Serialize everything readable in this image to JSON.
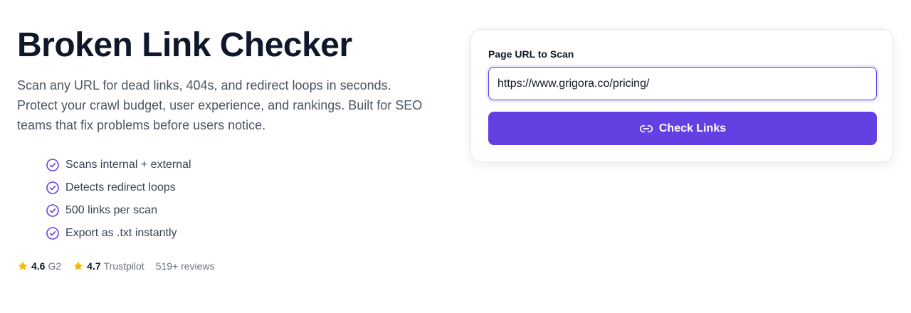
{
  "hero": {
    "title": "Broken Link Checker",
    "description": "Scan any URL for dead links, 404s, and redirect loops in seconds. Protect your crawl budget, user experience, and rankings. Built for SEO teams that fix problems before users notice."
  },
  "features": [
    {
      "icon": "check-circle-icon",
      "label": "Scans internal + external"
    },
    {
      "icon": "check-circle-icon",
      "label": "Detects redirect loops"
    },
    {
      "icon": "check-circle-icon",
      "label": "500 links per scan"
    },
    {
      "icon": "check-circle-icon",
      "label": "Export as .txt instantly"
    }
  ],
  "ratings": [
    {
      "icon": "star-icon",
      "score": "4.6",
      "source": "G2"
    },
    {
      "icon": "star-icon",
      "score": "4.7",
      "source": "Trustpilot"
    }
  ],
  "reviews": "519+ reviews",
  "form": {
    "label": "Page URL to Scan",
    "url_value": "https://www.grigora.co/pricing/",
    "button_label": "Check Links",
    "button_icon": "link-icon"
  },
  "colors": {
    "accent": "#6440e3",
    "star": "#f5b800",
    "text_dark": "#0f172a",
    "text_muted": "#4b5563"
  }
}
